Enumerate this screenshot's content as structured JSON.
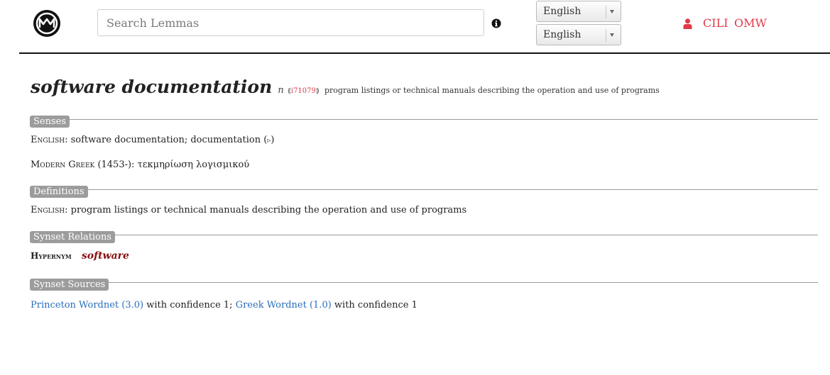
{
  "header": {
    "logo_icon": "omw-logo-icon",
    "search": {
      "placeholder": "Search Lemmas",
      "value": ""
    },
    "info_icon": "info-circle-icon",
    "language_selects": [
      {
        "value": "English"
      },
      {
        "value": "English"
      }
    ],
    "user_icon": "user-icon",
    "nav": {
      "cili": "CILI",
      "omw": "OMW"
    },
    "colors": {
      "link_red": "#e03a4a",
      "rule": "#111111"
    }
  },
  "synset": {
    "title": "software documentation",
    "pos": "n",
    "ili_open": "⟪",
    "ili_id": "i71079",
    "ili_close": "⟫",
    "gloss": "program listings or technical manuals describing the operation and use of programs"
  },
  "sections": {
    "senses": {
      "label": "Senses",
      "rows": [
        {
          "language": "English",
          "text": "software documentation; documentation",
          "play_open": "(",
          "play_icon": "▹",
          "play_close": ")"
        },
        {
          "language": "Modern Greek",
          "text": "(1453-): τεκμηρίωση λογισμικού"
        }
      ]
    },
    "definitions": {
      "label": "Definitions",
      "rows": [
        {
          "language": "English",
          "text": "program listings or technical manuals describing the operation and use of programs"
        }
      ]
    },
    "relations": {
      "label": "Synset Relations",
      "rows": [
        {
          "relation": "Hypernym",
          "target": "software"
        }
      ]
    },
    "sources": {
      "label": "Synset Sources",
      "items": [
        {
          "name": "Princeton Wordnet (3.0)",
          "suffix": "with confidence 1;"
        },
        {
          "name": "Greek Wordnet (1.0)",
          "suffix": "with confidence 1"
        }
      ]
    }
  }
}
